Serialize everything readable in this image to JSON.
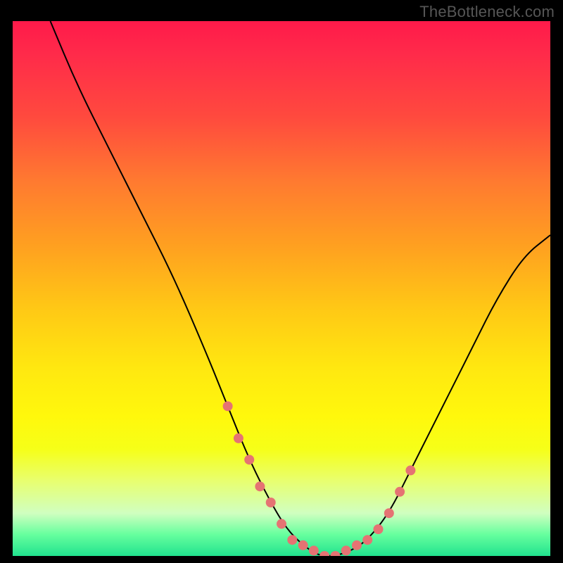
{
  "watermark": "TheBottleneck.com",
  "chart_data": {
    "type": "line",
    "title": "",
    "xlabel": "",
    "ylabel": "",
    "xlim": [
      0,
      100
    ],
    "ylim": [
      0,
      100
    ],
    "series": [
      {
        "name": "bottleneck-curve",
        "x": [
          7,
          12,
          18,
          24,
          30,
          36,
          40,
          44,
          48,
          51,
          54,
          57,
          60,
          63,
          66,
          70,
          74,
          78,
          82,
          86,
          90,
          95,
          100
        ],
        "y": [
          100,
          88,
          76,
          64,
          52,
          38,
          28,
          18,
          10,
          5,
          2,
          0,
          0,
          1,
          3,
          8,
          16,
          24,
          32,
          40,
          48,
          56,
          60
        ]
      }
    ],
    "highlighted_points": {
      "name": "highlight-dots",
      "x": [
        40,
        42,
        44,
        46,
        48,
        50,
        52,
        54,
        56,
        58,
        60,
        62,
        64,
        66,
        68,
        70,
        72,
        74
      ],
      "y": [
        28,
        22,
        18,
        13,
        10,
        6,
        3,
        2,
        1,
        0,
        0,
        1,
        2,
        3,
        5,
        8,
        12,
        16
      ]
    },
    "colors": {
      "gradient_top": "#ff1a4a",
      "gradient_mid": "#ffe810",
      "gradient_bottom": "#21e28e",
      "curve": "#000000",
      "dots": "#e57373"
    }
  }
}
